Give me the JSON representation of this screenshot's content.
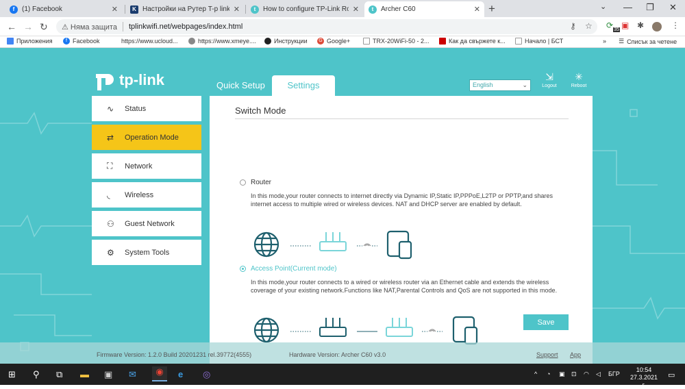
{
  "browser": {
    "tabs": [
      {
        "title": "(1) Facebook",
        "icon": "facebook-icon",
        "active": false
      },
      {
        "title": "Настройки на Рутер T-p link Arc",
        "icon": "k-icon",
        "active": false
      },
      {
        "title": "How to configure TP-Link Router",
        "icon": "tplink-icon",
        "active": false
      },
      {
        "title": "Archer C60",
        "icon": "tplink-icon",
        "active": true
      }
    ],
    "security_label": "Няма защита",
    "url": "tplinkwifi.net/webpages/index.html",
    "extension_badge": "35",
    "bookmarks": [
      {
        "label": "Приложения",
        "icon": "apps-icon"
      },
      {
        "label": "Facebook",
        "icon": "facebook-icon"
      },
      {
        "label": "https://www.ucloud...",
        "icon": "page-icon"
      },
      {
        "label": "https://www.xmeye....",
        "icon": "globe-icon"
      },
      {
        "label": "Инструкции",
        "icon": "github-icon"
      },
      {
        "label": "Google+",
        "icon": "google-plus-icon"
      },
      {
        "label": "TRX-20WiFi-50 - 2...",
        "icon": "page-icon"
      },
      {
        "label": "Как да свържете к...",
        "icon": "grammarly-icon"
      },
      {
        "label": "Начало | БСТ",
        "icon": "page-icon"
      }
    ],
    "bookmarks_overflow": "»",
    "reading_list": "Списък за четене"
  },
  "router": {
    "brand": "tp-link",
    "tabs": {
      "quick_setup": "Quick Setup",
      "settings": "Settings"
    },
    "language": "English",
    "logout": "Logout",
    "reboot": "Reboot",
    "sidebar": [
      {
        "label": "Status",
        "icon": "pulse-icon",
        "active": false
      },
      {
        "label": "Operation Mode",
        "icon": "switch-icon",
        "active": true
      },
      {
        "label": "Network",
        "icon": "network-icon",
        "active": false
      },
      {
        "label": "Wireless",
        "icon": "wifi-icon",
        "active": false
      },
      {
        "label": "Guest Network",
        "icon": "users-icon",
        "active": false
      },
      {
        "label": "System Tools",
        "icon": "gear-icon",
        "active": false
      }
    ],
    "section_title": "Switch Mode",
    "mode_router": {
      "label": "Router",
      "selected": false,
      "description": "In this mode,your router connects to internet directly via Dynamic IP,Static IP,PPPoE,L2TP or PPTP,and shares internet access to multiple wired or wireless devices. NAT and DHCP server are enabled by default."
    },
    "mode_ap": {
      "label": "Access Point(Current mode)",
      "selected": true,
      "description": "In this mode,your router connects to a wired or wireless router via an Ethernet cable and extends the wireless coverage of your existing network.Functions like NAT,Parental Controls and QoS are not supported in this mode."
    },
    "save_label": "Save",
    "footer": {
      "firmware": "Firmware Version: 1.2.0 Build 20201231 rel.39772(4555)",
      "hardware": "Hardware Version: Archer C60 v3.0",
      "support": "Support",
      "app": "App"
    },
    "accent_color": "#4ec4c9",
    "active_color": "#f5c518"
  },
  "taskbar": {
    "language": "БГР",
    "time": "10:54",
    "date": "27.3.2021 г."
  }
}
